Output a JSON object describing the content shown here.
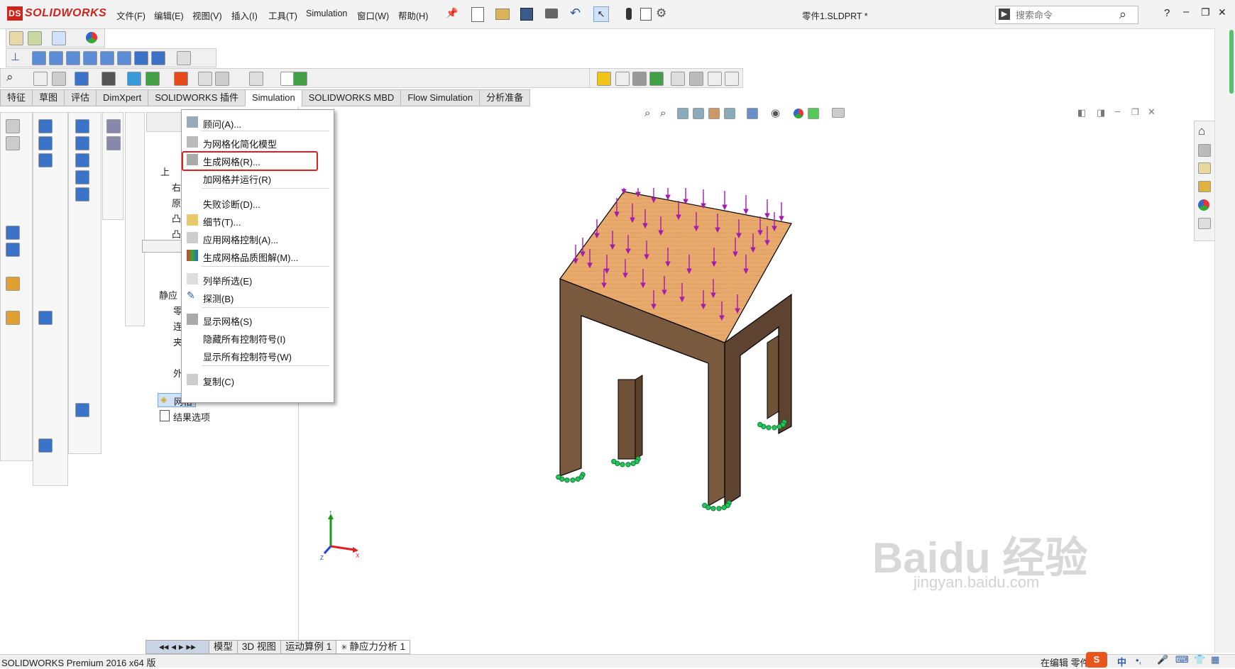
{
  "app": {
    "logo_text": "SOLIDWORKS",
    "logo_mark": "DS"
  },
  "menubar": [
    "文件(F)",
    "编辑(E)",
    "视图(V)",
    "插入(I)",
    "工具(T)",
    "Simulation",
    "窗口(W)",
    "帮助(H)"
  ],
  "document_title": "零件1.SLDPRT *",
  "search": {
    "placeholder": "搜索命令"
  },
  "window_controls": {
    "help": "?",
    "minimize": "–",
    "restore": "❐",
    "close": "✕"
  },
  "command_tabs": [
    "特征",
    "草图",
    "评估",
    "DimXpert",
    "SOLIDWORKS 插件",
    "Simulation",
    "SOLIDWORKS MBD",
    "Flow Simulation",
    "分析准备"
  ],
  "active_tab": "Simulation",
  "context_menu": {
    "items": [
      {
        "label": "顾问(A)...",
        "icon": "advisor-icon"
      },
      {
        "label": "为网格化简化模型",
        "icon": "simplify-icon"
      },
      {
        "label": "生成网格(R)...",
        "icon": "create-mesh-icon",
        "highlighted": true
      },
      {
        "label": "加网格并运行(R)",
        "icon": ""
      },
      {
        "label": "失败诊断(D)...",
        "icon": ""
      },
      {
        "label": "细节(T)...",
        "icon": "details-icon"
      },
      {
        "label": "应用网格控制(A)...",
        "icon": "mesh-control-icon"
      },
      {
        "label": "生成网格品质图解(M)...",
        "icon": "mesh-quality-icon"
      },
      {
        "label": "列举所选(E)",
        "icon": "list-selected-icon"
      },
      {
        "label": "探测(B)",
        "icon": "probe-icon"
      },
      {
        "label": "显示网格(S)",
        "icon": "show-mesh-icon"
      },
      {
        "label": "隐藏所有控制符号(I)",
        "icon": ""
      },
      {
        "label": "显示所有控制符号(W)",
        "icon": ""
      },
      {
        "label": "复制(C)",
        "icon": "copy-icon"
      }
    ]
  },
  "tree": {
    "study_partial": "静应",
    "fixtures_partial": "夹",
    "connections_partial": "连",
    "parts_partial": "零",
    "loads_partial": "外",
    "mesh": "网格",
    "result_options": "结果选项",
    "partial_labels": [
      "上",
      "右",
      "原",
      "凸",
      "凸"
    ]
  },
  "bottom_tabs": [
    "模型",
    "3D 视图",
    "运动算例 1",
    "静应力分析 1"
  ],
  "active_bottom_tab": "静应力分析 1",
  "status_left": "SOLIDWORKS Premium 2016 x64 版",
  "status_right": "在编辑 零件",
  "ime": {
    "mode": "中"
  },
  "watermark": {
    "brand": "Baidu 经验",
    "url": "jingyan.baidu.com"
  },
  "axes": {
    "x": "X",
    "y": "Y",
    "z": "Z"
  },
  "colors": {
    "highlight_box": "#e02020",
    "load_arrow": "#a21caf",
    "fixture": "#22c55e",
    "tabletop": "#e5a56a",
    "legs": "#7a5a3e"
  }
}
